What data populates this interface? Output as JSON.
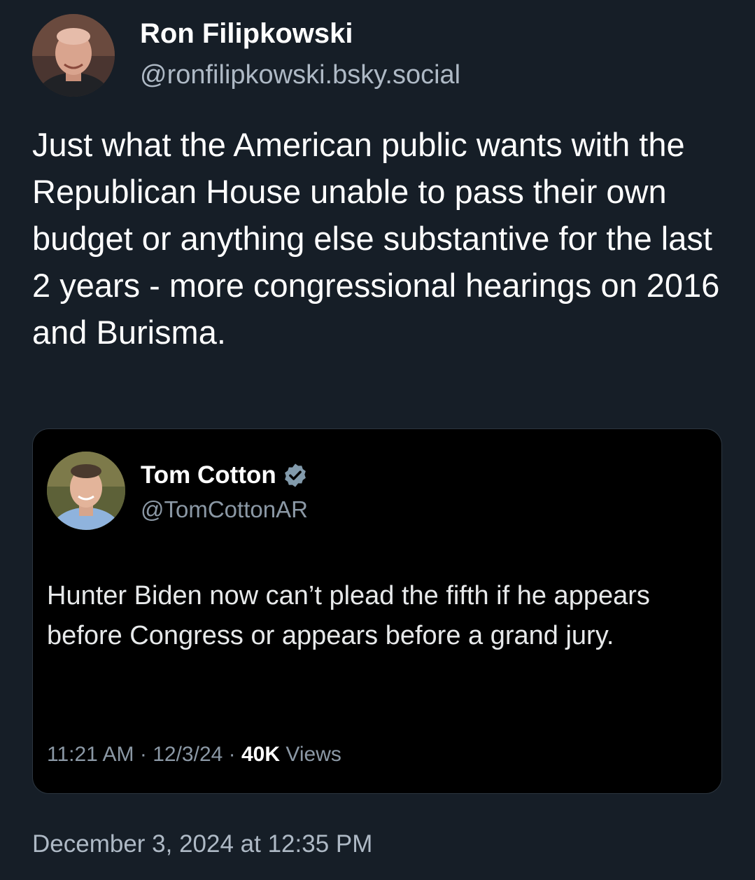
{
  "post": {
    "author_name": "Ron Filipkowski",
    "author_handle": "@ronfilipkowski.bsky.social",
    "avatar_icon": "user-avatar-icon",
    "text": "Just what the American public wants with the Republican House unable to pass their own budget or anything else substantive for the last 2 years - more congressional hearings on 2016 and Burisma.",
    "timestamp": "December 3, 2024 at 12:35 PM"
  },
  "quote": {
    "author_name": "Tom Cotton",
    "author_handle": "@TomCottonAR",
    "avatar_icon": "user-avatar-icon",
    "verified_icon": "verified-badge-icon",
    "text": "Hunter Biden now can’t plead the fifth if he appears before Congress or appears before a grand jury.",
    "time": "11:21 AM",
    "date": "12/3/24",
    "separator": "·",
    "views_count": "40K",
    "views_label": "Views"
  },
  "colors": {
    "page_background": "#161e27",
    "card_background": "#000000",
    "muted_text": "#8b98a5",
    "verified_badge": "#829aab"
  }
}
